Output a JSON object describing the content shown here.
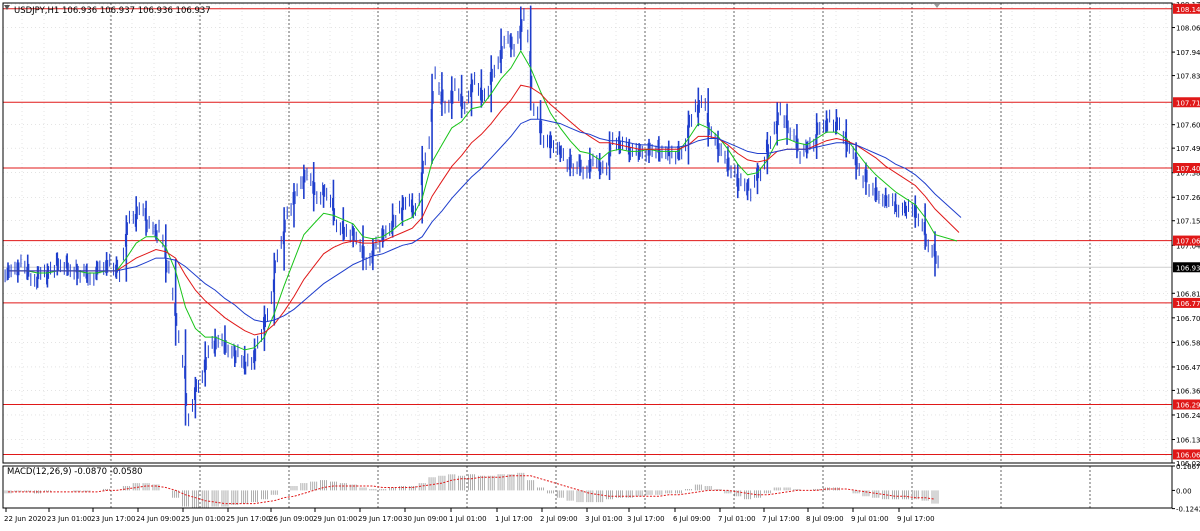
{
  "header": {
    "symbol_info": "USDJPY,H1  106.936 106.937 106.936 106.937"
  },
  "macd_header": {
    "label": "MACD(12,26,9) -0.0870 -0.0580"
  },
  "current_price_label": "106.937",
  "colors": {
    "background": "#ffffff",
    "candles": "#1f3ecc",
    "ma_fast": "#18c418",
    "ma_mid": "#e01818",
    "ma_slow": "#1f3ecc",
    "levels": "#e01818",
    "macd_hist": "#9a9a9a",
    "macd_signal": "#e01818",
    "grid": "#000000"
  },
  "chart_data": [
    {
      "type": "line",
      "title": "USDJPY,H1",
      "ylim": [
        106.02,
        108.175
      ],
      "y_ticks": [
        "108.170",
        "108.060",
        "107.945",
        "107.835",
        "107.605",
        "107.495",
        "107.380",
        "107.265",
        "107.155",
        "107.040",
        "106.815",
        "106.700",
        "106.585",
        "106.470",
        "106.360",
        "106.245",
        "106.130",
        "106.020"
      ],
      "x_ticks": [
        "22 Jun 2020",
        "23 Jun 01:00",
        "23 Jun 17:00",
        "24 Jun 09:00",
        "25 Jun 01:00",
        "25 Jun 17:00",
        "26 Jun 09:00",
        "29 Jun 01:00",
        "29 Jun 17:00",
        "30 Jun 09:00",
        "1 Jul 01:00",
        "1 Jul 17:00",
        "2 Jul 09:00",
        "3 Jul 01:00",
        "3 Jul 17:00",
        "6 Jul 09:00",
        "7 Jul 01:00",
        "7 Jul 17:00",
        "8 Jul 09:00",
        "9 Jul 01:00",
        "9 Jul 17:00"
      ],
      "levels": [
        "108.148",
        "107.710",
        "107.402",
        "107.062",
        "106.770",
        "106.294",
        "106.060"
      ],
      "current_price": 106.937,
      "grid": true,
      "series": [
        {
          "values": [
            106.92,
            106.95,
            106.9,
            106.88,
            106.93,
            106.96,
            106.93,
            106.91,
            106.9,
            106.93,
            106.95,
            106.92,
            107.15,
            107.22,
            107.12,
            107.1,
            106.92,
            106.6,
            106.25,
            106.4,
            106.55,
            106.62,
            106.55,
            106.52,
            106.48,
            106.58,
            106.72,
            106.98,
            107.18,
            107.28,
            107.38,
            107.25,
            107.3,
            107.16,
            107.1,
            107.08,
            106.95,
            107.05,
            107.1,
            107.18,
            107.25,
            107.2,
            107.45,
            107.82,
            107.68,
            107.78,
            107.68,
            107.82,
            107.72,
            107.88,
            108.0,
            107.98,
            108.12,
            107.7,
            107.55,
            107.48,
            107.45,
            107.42,
            107.4,
            107.45,
            107.38,
            107.55,
            107.5,
            107.47,
            107.48,
            107.5,
            107.48,
            107.48,
            107.47,
            107.65,
            107.72,
            107.55,
            107.48,
            107.4,
            107.32,
            107.3,
            107.4,
            107.55,
            107.68,
            107.55,
            107.48,
            107.5,
            107.6,
            107.62,
            107.58,
            107.48,
            107.38,
            107.32,
            107.28,
            107.25,
            107.22,
            107.22,
            107.18,
            107.06,
            106.94
          ]
        },
        {
          "name": "",
          "values": [
            106.92,
            106.92,
            106.92,
            106.91,
            106.91,
            106.92,
            106.92,
            106.92,
            106.91,
            106.91,
            106.92,
            106.92,
            106.98,
            107.05,
            107.08,
            107.08,
            107.03,
            106.92,
            106.75,
            106.65,
            106.61,
            106.61,
            106.59,
            106.57,
            106.55,
            106.56,
            106.61,
            106.72,
            106.85,
            106.97,
            107.09,
            107.14,
            107.19,
            107.18,
            107.16,
            107.14,
            107.08,
            107.07,
            107.08,
            107.11,
            107.15,
            107.17,
            107.26,
            107.43,
            107.51,
            107.59,
            107.62,
            107.68,
            107.69,
            107.75,
            107.82,
            107.87,
            107.95,
            107.87,
            107.76,
            107.66,
            107.59,
            107.53,
            107.48,
            107.47,
            107.44,
            107.48,
            107.49,
            107.48,
            107.48,
            107.49,
            107.48,
            107.48,
            107.48,
            107.54,
            107.61,
            107.59,
            107.55,
            107.49,
            107.42,
            107.37,
            107.38,
            107.44,
            107.53,
            107.54,
            107.52,
            107.51,
            107.54,
            107.57,
            107.57,
            107.54,
            107.48,
            107.42,
            107.37,
            107.33,
            107.29,
            107.26,
            107.23,
            107.17,
            107.09
          ]
        },
        {
          "name": "",
          "values": [
            106.92,
            106.92,
            106.92,
            106.92,
            106.92,
            106.92,
            106.92,
            106.92,
            106.92,
            106.92,
            106.92,
            106.92,
            106.95,
            106.98,
            107.0,
            107.02,
            107.01,
            106.98,
            106.9,
            106.83,
            106.78,
            106.74,
            106.7,
            106.67,
            106.64,
            106.62,
            106.63,
            106.67,
            106.73,
            106.8,
            106.88,
            106.94,
            107.0,
            107.03,
            107.05,
            107.06,
            107.05,
            107.05,
            107.06,
            107.08,
            107.1,
            107.12,
            107.17,
            107.27,
            107.34,
            107.41,
            107.46,
            107.52,
            107.56,
            107.61,
            107.67,
            107.72,
            107.79,
            107.78,
            107.75,
            107.7,
            107.66,
            107.62,
            107.58,
            107.55,
            107.52,
            107.52,
            107.51,
            107.5,
            107.49,
            107.49,
            107.49,
            107.49,
            107.49,
            107.51,
            107.55,
            107.55,
            107.54,
            107.51,
            107.47,
            107.44,
            107.43,
            107.44,
            107.48,
            107.49,
            107.49,
            107.49,
            107.51,
            107.53,
            107.54,
            107.53,
            107.51,
            107.48,
            107.45,
            107.41,
            107.38,
            107.35,
            107.32,
            107.27,
            107.21
          ]
        },
        {
          "name": "",
          "values": [
            106.92,
            106.92,
            106.92,
            106.92,
            106.92,
            106.92,
            106.92,
            106.92,
            106.92,
            106.92,
            106.92,
            106.92,
            106.93,
            106.94,
            106.96,
            106.98,
            106.98,
            106.97,
            106.94,
            106.9,
            106.86,
            106.83,
            106.79,
            106.76,
            106.72,
            106.69,
            106.68,
            106.69,
            106.71,
            106.74,
            106.78,
            106.82,
            106.86,
            106.89,
            106.92,
            106.95,
            106.97,
            106.99,
            107.0,
            107.02,
            107.04,
            107.05,
            107.08,
            107.15,
            107.2,
            107.26,
            107.31,
            107.36,
            107.4,
            107.45,
            107.5,
            107.55,
            107.61,
            107.63,
            107.63,
            107.62,
            107.61,
            107.59,
            107.57,
            107.56,
            107.54,
            107.53,
            107.53,
            107.52,
            107.51,
            107.51,
            107.5,
            107.5,
            107.5,
            107.51,
            107.53,
            107.54,
            107.54,
            107.52,
            107.5,
            107.48,
            107.47,
            107.47,
            107.48,
            107.49,
            107.49,
            107.49,
            107.5,
            107.51,
            107.52,
            107.52,
            107.51,
            107.49,
            107.47,
            107.45,
            107.42,
            107.4,
            107.37,
            107.33,
            107.28
          ]
        }
      ]
    },
    {
      "type": "bar",
      "title": "MACD(12,26,9)",
      "ylim": [
        -0.12,
        0.1667
      ],
      "y_ticks": [
        "0.1667",
        "0.00",
        "-0.1242"
      ],
      "series": [
        {
          "values": [
            -0.02,
            -0.01,
            -0.01,
            -0.02,
            -0.01,
            0.0,
            0.0,
            -0.01,
            -0.01,
            0.0,
            0.01,
            0.0,
            0.03,
            0.05,
            0.05,
            0.04,
            0.0,
            -0.05,
            -0.11,
            -0.12,
            -0.12,
            -0.11,
            -0.11,
            -0.1,
            -0.09,
            -0.08,
            -0.06,
            -0.03,
            0.0,
            0.03,
            0.05,
            0.06,
            0.07,
            0.06,
            0.05,
            0.04,
            0.02,
            0.01,
            0.01,
            0.02,
            0.03,
            0.03,
            0.05,
            0.09,
            0.1,
            0.11,
            0.1,
            0.11,
            0.1,
            0.1,
            0.11,
            0.11,
            0.12,
            0.07,
            0.02,
            -0.02,
            -0.05,
            -0.07,
            -0.08,
            -0.08,
            -0.08,
            -0.06,
            -0.05,
            -0.05,
            -0.04,
            -0.03,
            -0.03,
            -0.02,
            -0.02,
            0.01,
            0.04,
            0.03,
            0.01,
            -0.02,
            -0.04,
            -0.06,
            -0.05,
            -0.02,
            0.02,
            0.02,
            0.01,
            0.0,
            0.01,
            0.02,
            0.02,
            0.0,
            -0.02,
            -0.04,
            -0.05,
            -0.06,
            -0.06,
            -0.06,
            -0.06,
            -0.07,
            -0.09
          ]
        },
        {
          "name": "",
          "values": [
            -0.01,
            -0.01,
            -0.01,
            -0.01,
            -0.01,
            -0.01,
            -0.01,
            -0.01,
            -0.01,
            -0.01,
            0.0,
            0.0,
            0.01,
            0.02,
            0.03,
            0.03,
            0.02,
            0.0,
            -0.03,
            -0.05,
            -0.07,
            -0.08,
            -0.09,
            -0.09,
            -0.09,
            -0.09,
            -0.08,
            -0.07,
            -0.05,
            -0.04,
            -0.02,
            0.0,
            0.02,
            0.03,
            0.03,
            0.03,
            0.03,
            0.03,
            0.02,
            0.02,
            0.02,
            0.02,
            0.03,
            0.04,
            0.05,
            0.07,
            0.08,
            0.08,
            0.09,
            0.09,
            0.09,
            0.1,
            0.1,
            0.1,
            0.08,
            0.06,
            0.04,
            0.02,
            0.0,
            -0.02,
            -0.03,
            -0.04,
            -0.04,
            -0.04,
            -0.04,
            -0.04,
            -0.04,
            -0.03,
            -0.03,
            -0.02,
            -0.01,
            0.0,
            0.0,
            0.0,
            -0.01,
            -0.02,
            -0.03,
            -0.03,
            -0.02,
            -0.01,
            0.0,
            0.0,
            0.0,
            0.01,
            0.01,
            0.01,
            0.0,
            -0.01,
            -0.02,
            -0.03,
            -0.04,
            -0.04,
            -0.05,
            -0.05,
            -0.06
          ]
        }
      ]
    }
  ]
}
